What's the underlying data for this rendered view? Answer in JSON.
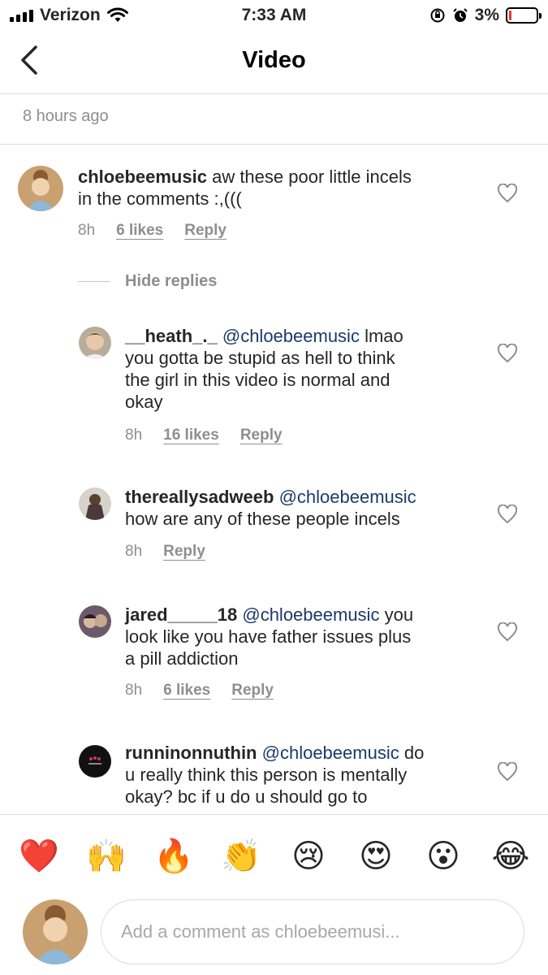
{
  "status_bar": {
    "carrier": "Verizon",
    "time": "7:33 AM",
    "battery_percent": "3%",
    "battery_level": 0.03,
    "icons": [
      "signal-icon",
      "wifi-icon",
      "orientation-lock-icon",
      "alarm-icon",
      "battery-icon"
    ]
  },
  "nav": {
    "title": "Video",
    "back_icon": "chevron-left-icon"
  },
  "post": {
    "time_ago": "8 hours ago"
  },
  "hide_replies_label": "Hide replies",
  "comments": [
    {
      "username": "chloebeemusic",
      "mention": "",
      "text_line1": "aw these poor little incels",
      "text_line2": "in the comments :,(((",
      "time": "8h",
      "likes": "6 likes",
      "reply": "Reply"
    }
  ],
  "replies": [
    {
      "username": "__heath_._",
      "mention": "@chloebeemusic",
      "line1": "lmao",
      "line2": "you gotta be stupid as hell to think",
      "line3": "the girl in this video is normal and",
      "line4": "okay",
      "time": "8h",
      "likes": "16 likes",
      "reply": "Reply"
    },
    {
      "username": "thereallysadweeb",
      "mention": "@chloebeemusic",
      "line1": "",
      "line2": "how are any of these people incels",
      "time": "8h",
      "reply": "Reply"
    },
    {
      "username": "jared_____18",
      "mention": "@chloebeemusic",
      "line1": "you",
      "line2": "look like you have father issues plus",
      "line3": "a pill addiction",
      "time": "8h",
      "likes": "6 likes",
      "reply": "Reply"
    },
    {
      "username": "runninonnuthin",
      "mention": "@chloebeemusic",
      "line1": "do",
      "line2": "u really think this person is mentally",
      "line3": "okay? bc if u do u should go to"
    }
  ],
  "reactions": [
    "❤️",
    "🙌",
    "🔥",
    "👏",
    "😢",
    "😍",
    "😮",
    "😂"
  ],
  "composer": {
    "placeholder": "Add a comment as chloebeemusi..."
  },
  "colors": {
    "accent_mention": "#1a3a6b",
    "muted": "#8e8e8e",
    "divider": "#dbdbdb",
    "heart": "#e8243c"
  }
}
